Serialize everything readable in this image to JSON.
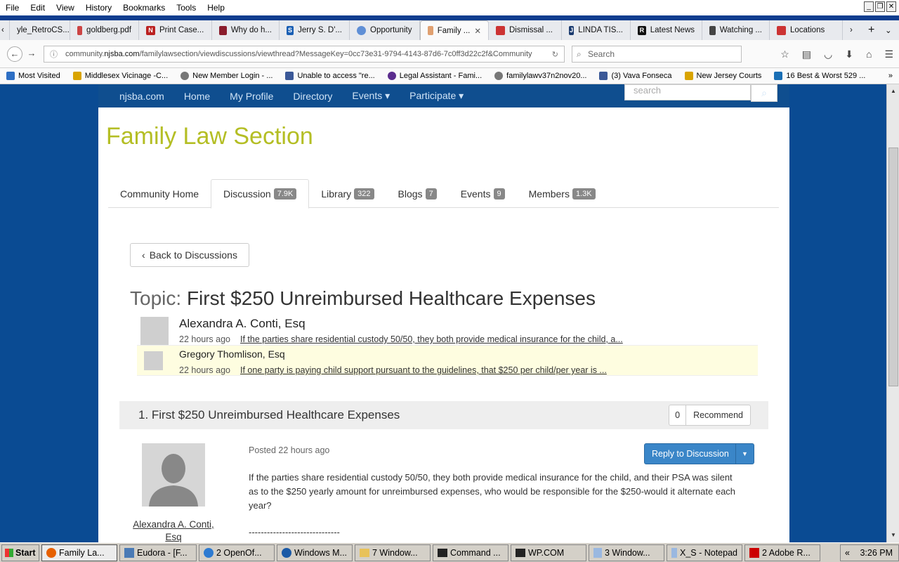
{
  "menu": [
    "File",
    "Edit",
    "View",
    "History",
    "Bookmarks",
    "Tools",
    "Help"
  ],
  "tabs": [
    {
      "label": "yle_RetroCS...",
      "icon": ""
    },
    {
      "label": "goldberg.pdf",
      "icon": ""
    },
    {
      "label": "Print Case...",
      "icon": "N"
    },
    {
      "label": "Why do h...",
      "icon": ""
    },
    {
      "label": "Jerry S. D'...",
      "icon": "S"
    },
    {
      "label": "Opportunity",
      "icon": ""
    },
    {
      "label": "Family ...",
      "icon": "",
      "active": true
    },
    {
      "label": "Dismissal ...",
      "icon": ""
    },
    {
      "label": "LINDA TIS...",
      "icon": "J"
    },
    {
      "label": "Latest News",
      "icon": "R"
    },
    {
      "label": "Watching ...",
      "icon": ""
    },
    {
      "label": "Locations",
      "icon": ""
    }
  ],
  "url": {
    "prefix": "community.",
    "domain": "njsba.com",
    "rest": "/familylawsection/viewdiscussions/viewthread?MessageKey=0cc73e31-9794-4143-87d6-7c0ff3d22c2f&Community"
  },
  "search_placeholder": "Search",
  "bookmarks": [
    {
      "label": "Most Visited",
      "color": "#2e6fc4"
    },
    {
      "label": "Middlesex Vicinage -C...",
      "color": "#d9a400"
    },
    {
      "label": "New Member Login - ...",
      "color": "#777"
    },
    {
      "label": "Unable to access \"re...",
      "color": "#3b5998"
    },
    {
      "label": "Legal Assistant - Fami...",
      "color": "#5b2d8e"
    },
    {
      "label": "familylawv37n2nov20...",
      "color": "#777"
    },
    {
      "label": "(3) Vava Fonseca",
      "color": "#3b5998"
    },
    {
      "label": "New Jersey Courts",
      "color": "#d9a400"
    },
    {
      "label": "16 Best & Worst 529 ...",
      "color": "#1a6fb5"
    }
  ],
  "site_nav": [
    "njsba.com",
    "Home",
    "My Profile",
    "Directory",
    "Events ▾",
    "Participate ▾"
  ],
  "site_search_placeholder": "search",
  "section_title": "Family Law Section",
  "nav_tabs": [
    {
      "label": "Community Home",
      "badge": ""
    },
    {
      "label": "Discussion",
      "badge": "7.9K",
      "active": true
    },
    {
      "label": "Library",
      "badge": "322"
    },
    {
      "label": "Blogs",
      "badge": "7"
    },
    {
      "label": "Events",
      "badge": "9"
    },
    {
      "label": "Members",
      "badge": "1.3K"
    }
  ],
  "back_label": "Back to Discussions",
  "topic_label": "Topic:",
  "topic_title": "First $250 Unreimbursed Healthcare Expenses",
  "thread": [
    {
      "name": "Alexandra A. Conti, Esq",
      "time": "22 hours ago",
      "snippet": "If the parties share residential custody 50/50, they both provide medical insurance for the child, a..."
    },
    {
      "name": "Gregory Thomlison, Esq",
      "time": "22 hours ago",
      "snippet": "If one party is paying child support pursuant to the guidelines, that $250 per child/per year is ..."
    }
  ],
  "message": {
    "header": "1.  First $250 Unreimbursed Healthcare Expenses",
    "recommend_count": "0",
    "recommend_label": "Recommend",
    "posted": "Posted 22 hours ago",
    "reply_label": "Reply to Discussion",
    "author": "Alexandra A. Conti, Esq",
    "body": "If the parties share residential custody 50/50, they both provide medical insurance for the child, and their PSA was silent as to the $250 yearly amount for unreimbursed expenses, who would be responsible for the $250-would it alternate each year?",
    "separator": "------------------------------"
  },
  "taskbar": {
    "start": "Start",
    "items": [
      "Family La...",
      "Eudora - [F...",
      "2 OpenOf...",
      "Windows M...",
      "7 Window...",
      "Command ...",
      "WP.COM",
      "3 Window...",
      "X_S - Notepad",
      "2 Adobe R..."
    ],
    "clock": "3:26 PM"
  }
}
